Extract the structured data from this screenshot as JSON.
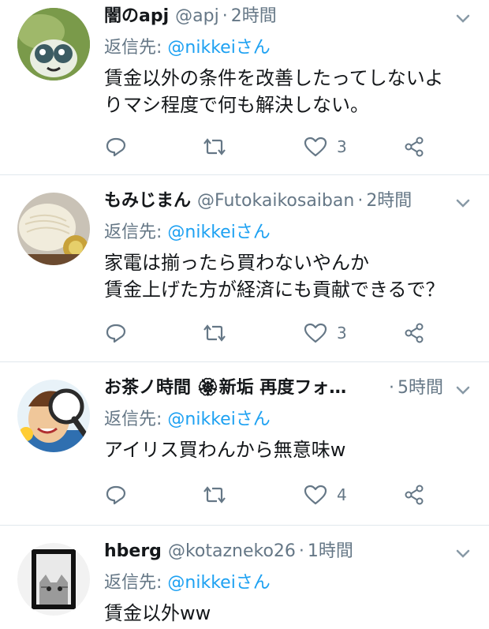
{
  "tweets": [
    {
      "name": "闇のapj",
      "handle": "@apj",
      "time": "2時間",
      "reply_label": "返信先: ",
      "reply_to": "@nikkeiさん",
      "text_lines": [
        "賃金以外の条件を改善したってしないよ",
        "りマシ程度で何も解決しない。"
      ],
      "likes": "3",
      "avatar": "dragonfly-avatar"
    },
    {
      "name": "もみじまん",
      "handle": "@Futokaikosaiban",
      "time": "2時間",
      "reply_label": "返信先: ",
      "reply_to": "@nikkeiさん",
      "text_lines": [
        "家電は揃ったら買わないやんか",
        "賃金上げた方が経済にも貢献できるで？"
      ],
      "likes": "3",
      "avatar": "noodle-avatar"
    },
    {
      "name": "お茶ノ時間 🏵新垢 再度フォ…",
      "handle": "",
      "time": "5時間",
      "reply_label": "返信先: ",
      "reply_to": "@nikkeiさん",
      "text_lines": [
        "アイリス買わんから無意味w"
      ],
      "likes": "4",
      "avatar": "magnifier-avatar"
    },
    {
      "name": "hberg",
      "handle": "@kotazneko26",
      "time": "1時間",
      "reply_label": "返信先: ",
      "reply_to": "@nikkeiさん",
      "text_lines": [
        "賃金以外ww"
      ],
      "likes": "",
      "avatar": "cat-avatar"
    }
  ],
  "separator": "·",
  "colors": {
    "accent": "#1da1f2",
    "muted": "#657786",
    "text": "#14171a",
    "divider": "#e1e8ed"
  }
}
